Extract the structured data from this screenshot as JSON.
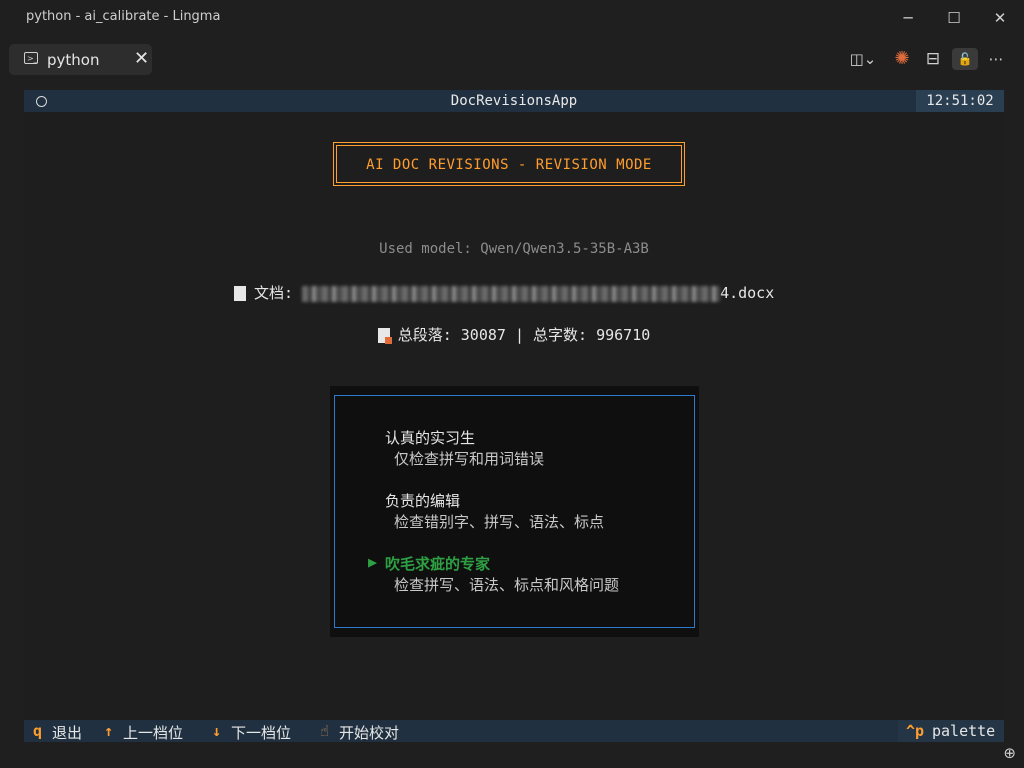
{
  "window": {
    "title": "python - ai_calibrate - Lingma",
    "minimize_glyph": "─",
    "maximize_glyph": "☐",
    "close_glyph": "✕"
  },
  "tab": {
    "label": "python",
    "close_glyph": "✕"
  },
  "toolbar": {
    "split_glyph": "◫⌄",
    "spark_glyph": "✺",
    "layout_glyph": "⊟",
    "lock_glyph": "🔓",
    "more_glyph": "⋯"
  },
  "terminal": {
    "header": {
      "app_title": "DocRevisionsApp",
      "clock": "12:51:02"
    },
    "banner": "AI DOC REVISIONS - REVISION MODE",
    "model_line": "Used model: Qwen/Qwen3.5-35B-A3B",
    "doc": {
      "label": "文档:",
      "filename_suffix": "4.docx"
    },
    "stats": {
      "text": "总段落: 30087 | 总字数: 996710"
    },
    "menu": {
      "items": [
        {
          "title": "认真的实习生",
          "desc": "仅检查拼写和用词错误"
        },
        {
          "title": "负责的编辑",
          "desc": "检查错别字、拼写、语法、标点"
        },
        {
          "title": "吹毛求疵的专家",
          "desc": "检查拼写、语法、标点和风格问题"
        }
      ],
      "selected_marker": "▶"
    },
    "footer": {
      "quit_key": "q",
      "quit_label": "退出",
      "up_key": "↑",
      "up_label": "上一档位",
      "down_key": "↓",
      "down_label": "下一档位",
      "start_key": "☝",
      "start_label": "开始校对",
      "palette_key": "^p",
      "palette_label": "palette"
    }
  },
  "colors": {
    "accent": "#ff9d2e",
    "selected": "#2ea043",
    "menu_border": "#2a7bd0",
    "header_bg": "#203040"
  }
}
